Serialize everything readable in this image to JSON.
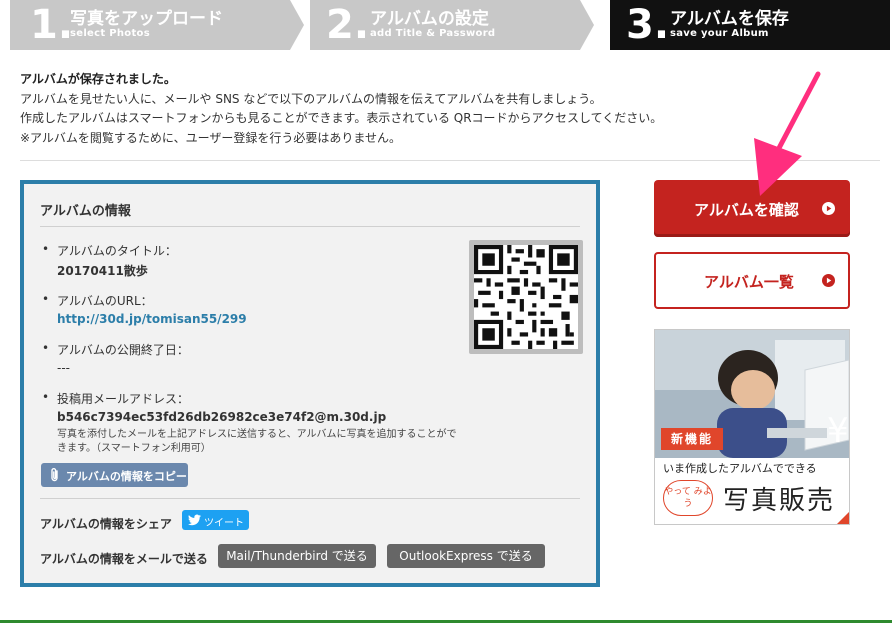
{
  "steps": [
    {
      "num": "1.",
      "title": "写真をアップロード",
      "sub": "select Photos"
    },
    {
      "num": "2.",
      "title": "アルバムの設定",
      "sub": "add Title & Password"
    },
    {
      "num": "3.",
      "title": "アルバムを保存",
      "sub": "save your Album"
    }
  ],
  "intro": {
    "lead": "アルバムが保存されました。",
    "lines": [
      "アルバムを見せたい人に、メールや SNS などで以下のアルバムの情報を伝えてアルバムを共有しましょう。",
      "作成したアルバムはスマートフォンからも見ることができます。表示されている QRコードからアクセスしてください。",
      "※アルバムを閲覧するために、ユーザー登録を行う必要はありません。"
    ]
  },
  "album_info": {
    "heading": "アルバムの情報",
    "items": [
      {
        "label": "アルバムのタイトル：",
        "value": "20170411散歩"
      },
      {
        "label": "アルバムのURL：",
        "value": "http://30d.jp/tomisan55/299"
      },
      {
        "label": "アルバムの公開終了日：",
        "value": "---"
      },
      {
        "label": "投稿用メールアドレス：",
        "value": "b546c7394ec53fd26db26982ce3e74f2@m.30d.jp",
        "note": "写真を添付したメールを上記アドレスに送信すると、アルバムに写真を追加することができます。（スマートフォン利用可）"
      }
    ],
    "copy_button": "アルバムの情報をコピー",
    "share_label": "アルバムの情報をシェア",
    "tweet_button": "ツイート",
    "mail_label": "アルバムの情報をメールで送る",
    "mail_thunderbird": "Mail/Thunderbird で送る",
    "mail_outlook": "OutlookExpress で送る"
  },
  "side": {
    "confirm_button": "アルバムを確認",
    "list_button": "アルバム一覧"
  },
  "ad": {
    "new_badge": "新機能",
    "caption": "いま作成したアルバムでできる",
    "badge": "やって みよう",
    "main": "写真販売"
  },
  "colors": {
    "accent_red": "#c4231f",
    "info_border": "#2c7ea9",
    "step_active": "#111111",
    "step_inactive": "#c8c8c8",
    "annotation_pink": "#ff2e7e",
    "tweet_blue": "#1da1f2"
  }
}
